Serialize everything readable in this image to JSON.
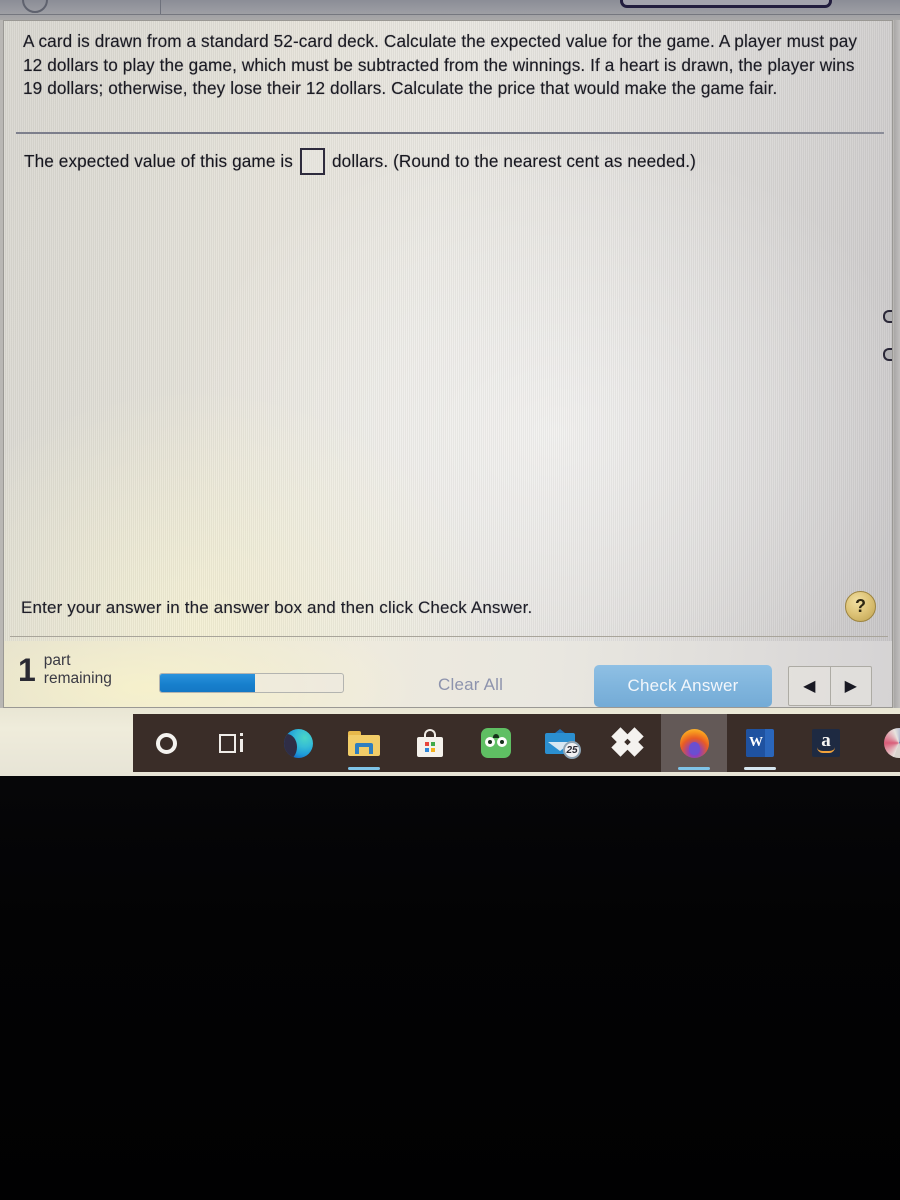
{
  "browser_chrome": {
    "reload_icon": "reload-circle-icon",
    "tab_button_label": ""
  },
  "exercise": {
    "problem_text": "A card is drawn from a standard 52-card deck. Calculate the expected value for the game. A player must pay 12 dollars to play the game, which must be subtracted from the winnings. If a heart is drawn, the player wins 19 dollars; otherwise, they lose their 12 dollars. Calculate the price that would make the game fair.",
    "answer_prompt_before": "The expected value of this game is",
    "answer_value": "",
    "answer_placeholder": "",
    "answer_prompt_after": "dollars. (Round to the nearest cent as needed.)"
  },
  "instruction": {
    "text": "Enter your answer in the answer box and then click Check Answer.",
    "help_label": "?"
  },
  "footer": {
    "parts_count": "1",
    "parts_label_line1": "part",
    "parts_label_line2": "remaining",
    "progress_percent": 52,
    "clear_all_label": "Clear All",
    "check_answer_label": "Check Answer",
    "nav_prev_label": "◀",
    "nav_next_label": "▶"
  },
  "colors": {
    "progress_fill": "#1780cd",
    "check_answer_bg": "#80b5dd",
    "clear_all_text": "#8d93ad",
    "help_badge": "#ddc377",
    "taskbar_bg": "#3a2d28"
  },
  "taskbar": {
    "items": [
      {
        "name": "cortana",
        "label": "Cortana"
      },
      {
        "name": "task-view",
        "label": "Task View"
      },
      {
        "name": "microsoft-edge",
        "label": "Microsoft Edge"
      },
      {
        "name": "file-explorer",
        "label": "File Explorer"
      },
      {
        "name": "microsoft-store",
        "label": "Microsoft Store"
      },
      {
        "name": "tripadvisor",
        "label": "Tripadvisor"
      },
      {
        "name": "mail",
        "label": "Mail",
        "badge": "25"
      },
      {
        "name": "dropbox",
        "label": "Dropbox"
      },
      {
        "name": "firefox",
        "label": "Firefox"
      },
      {
        "name": "microsoft-word",
        "label": "W"
      },
      {
        "name": "amazon",
        "label": "a"
      }
    ]
  }
}
